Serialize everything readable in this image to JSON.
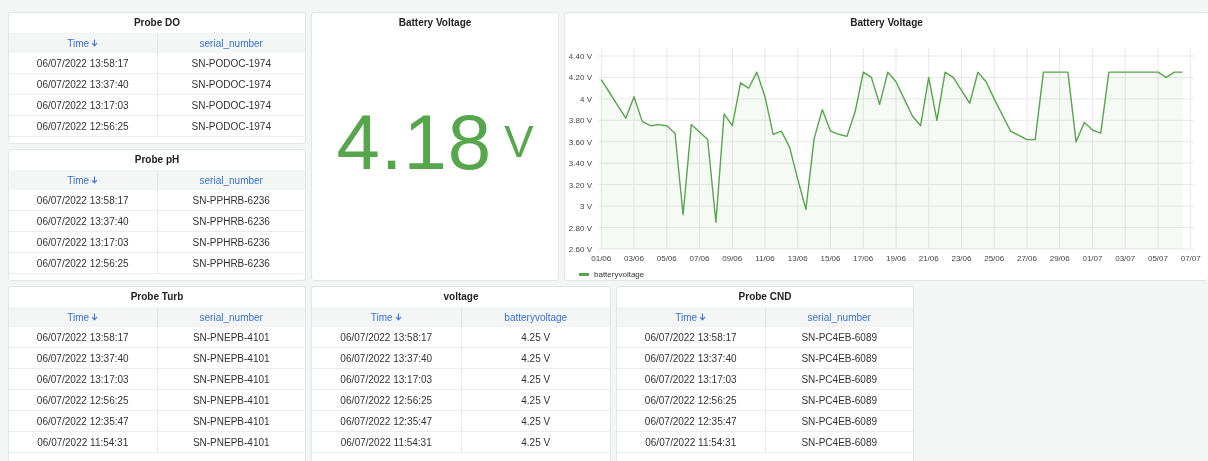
{
  "tables_top": [
    {
      "title": "Probe DO",
      "columns": [
        {
          "label": "Time",
          "sorted": true
        },
        {
          "label": "serial_number",
          "sorted": false
        }
      ],
      "rows": [
        [
          "06/07/2022 13:58:17",
          "SN-PODOC-1974"
        ],
        [
          "06/07/2022 13:37:40",
          "SN-PODOC-1974"
        ],
        [
          "06/07/2022 13:17:03",
          "SN-PODOC-1974"
        ],
        [
          "06/07/2022 12:56:25",
          "SN-PODOC-1974"
        ]
      ]
    },
    {
      "title": "Probe pH",
      "columns": [
        {
          "label": "Time",
          "sorted": true
        },
        {
          "label": "serial_number",
          "sorted": false
        }
      ],
      "rows": [
        [
          "06/07/2022 13:58:17",
          "SN-PPHRB-6236"
        ],
        [
          "06/07/2022 13:37:40",
          "SN-PPHRB-6236"
        ],
        [
          "06/07/2022 13:17:03",
          "SN-PPHRB-6236"
        ],
        [
          "06/07/2022 12:56:25",
          "SN-PPHRB-6236"
        ]
      ]
    }
  ],
  "stat": {
    "title": "Battery Voltage",
    "value": "4.18",
    "unit": "V"
  },
  "chart_panel": {
    "title": "Battery Voltage",
    "chart_data": {
      "type": "area",
      "grid": true,
      "categories": [
        "01/06",
        null,
        null,
        null,
        "03/06",
        null,
        null,
        null,
        "05/06",
        null,
        null,
        null,
        "07/06",
        null,
        null,
        null,
        "09/06",
        null,
        null,
        null,
        "11/06",
        null,
        null,
        null,
        "13/06",
        null,
        null,
        null,
        "15/06",
        null,
        null,
        null,
        "17/06",
        null,
        null,
        null,
        "19/06",
        null,
        null,
        null,
        "21/06",
        null,
        null,
        null,
        "23/06",
        null,
        null,
        null,
        "25/06",
        null,
        null,
        null,
        "27/06",
        null,
        null,
        null,
        "29/06",
        null,
        null,
        null,
        "01/07",
        null,
        null,
        null,
        "03/07",
        null,
        null,
        null,
        "05/07",
        null,
        null,
        null,
        "07/07"
      ],
      "series": [
        {
          "name": "batteryvoltage",
          "color": "#56a64b",
          "values": [
            4.18,
            4.06,
            3.94,
            3.82,
            4.02,
            3.79,
            3.75,
            3.76,
            3.75,
            3.68,
            2.92,
            3.76,
            3.69,
            3.62,
            2.85,
            3.86,
            3.75,
            4.15,
            4.1,
            4.25,
            4.02,
            3.67,
            3.7,
            3.55,
            3.25,
            2.97,
            3.63,
            3.9,
            3.7,
            3.67,
            3.65,
            3.88,
            4.25,
            4.2,
            3.95,
            4.25,
            4.16,
            4.0,
            3.84,
            3.75,
            4.2,
            3.8,
            4.25,
            4.2,
            4.08,
            3.96,
            4.25,
            4.16,
            4.0,
            3.85,
            3.7,
            3.66,
            3.62,
            3.62,
            4.25,
            4.25,
            4.25,
            4.25,
            3.6,
            3.78,
            3.71,
            3.68,
            4.25,
            4.25,
            4.25,
            4.25,
            4.25,
            4.25,
            4.25,
            4.2,
            4.25,
            4.25,
            null
          ]
        }
      ],
      "ylim": [
        2.6,
        4.4
      ],
      "yticks": [
        {
          "value": 2.6,
          "label": "2.60 V"
        },
        {
          "value": 2.8,
          "label": "2.80 V"
        },
        {
          "value": 3,
          "label": "3 V"
        },
        {
          "value": 3.2,
          "label": "3.20 V"
        },
        {
          "value": 3.4,
          "label": "3.40 V"
        },
        {
          "value": 3.6,
          "label": "3.60 V"
        },
        {
          "value": 3.8,
          "label": "3.80 V"
        },
        {
          "value": 4,
          "label": "4 V"
        },
        {
          "value": 4.2,
          "label": "4.20 V"
        },
        {
          "value": 4.4,
          "label": "4.40 V"
        }
      ]
    }
  },
  "tables_bottom": [
    {
      "title": "Probe Turb",
      "columns": [
        {
          "label": "Time",
          "sorted": true
        },
        {
          "label": "serial_number",
          "sorted": false
        }
      ],
      "rows": [
        [
          "06/07/2022 13:58:17",
          "SN-PNEPB-4101"
        ],
        [
          "06/07/2022 13:37:40",
          "SN-PNEPB-4101"
        ],
        [
          "06/07/2022 13:17:03",
          "SN-PNEPB-4101"
        ],
        [
          "06/07/2022 12:56:25",
          "SN-PNEPB-4101"
        ],
        [
          "06/07/2022 12:35:47",
          "SN-PNEPB-4101"
        ],
        [
          "06/07/2022 11:54:31",
          "SN-PNEPB-4101"
        ]
      ]
    },
    {
      "title": "voltage",
      "columns": [
        {
          "label": "Time",
          "sorted": true
        },
        {
          "label": "batteryvoltage",
          "sorted": false
        }
      ],
      "rows": [
        [
          "06/07/2022 13:58:17",
          "4.25 V"
        ],
        [
          "06/07/2022 13:37:40",
          "4.25 V"
        ],
        [
          "06/07/2022 13:17:03",
          "4.25 V"
        ],
        [
          "06/07/2022 12:56:25",
          "4.25 V"
        ],
        [
          "06/07/2022 12:35:47",
          "4.25 V"
        ],
        [
          "06/07/2022 11:54:31",
          "4.25 V"
        ]
      ]
    },
    {
      "title": "Probe CND",
      "columns": [
        {
          "label": "Time",
          "sorted": true
        },
        {
          "label": "serial_number",
          "sorted": false
        }
      ],
      "rows": [
        [
          "06/07/2022 13:58:17",
          "SN-PC4EB-6089"
        ],
        [
          "06/07/2022 13:37:40",
          "SN-PC4EB-6089"
        ],
        [
          "06/07/2022 13:17:03",
          "SN-PC4EB-6089"
        ],
        [
          "06/07/2022 12:56:25",
          "SN-PC4EB-6089"
        ],
        [
          "06/07/2022 12:35:47",
          "SN-PC4EB-6089"
        ],
        [
          "06/07/2022 11:54:31",
          "SN-PC4EB-6089"
        ]
      ]
    }
  ]
}
